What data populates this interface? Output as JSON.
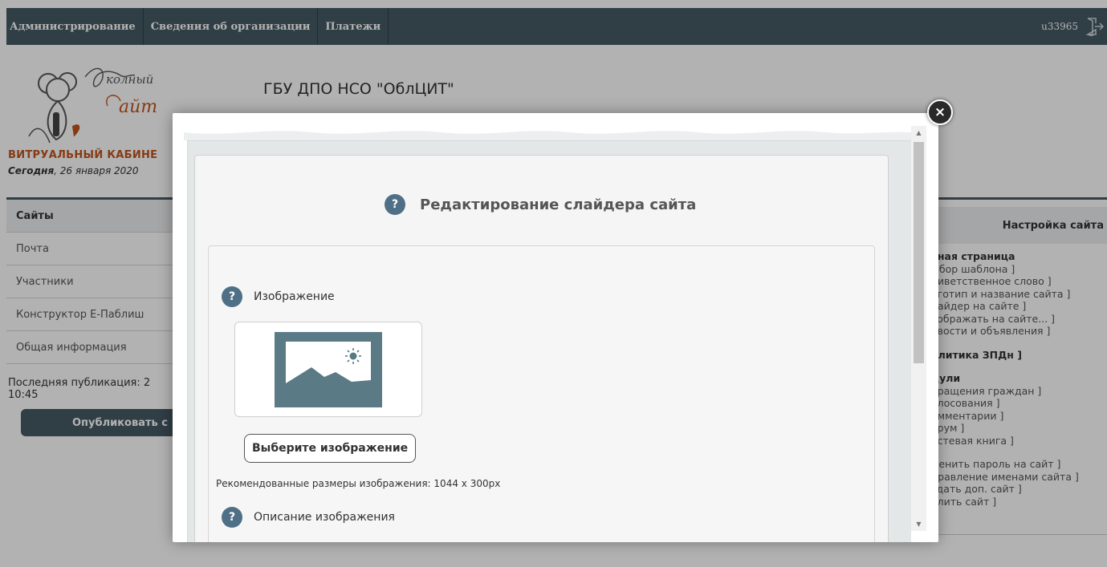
{
  "topnav": {
    "items": [
      "Администрирование",
      "Сведения об организации",
      "Платежи"
    ],
    "user": "u33965"
  },
  "header": {
    "cabinet_title": "ВИТРУАЛЬНЫЙ КАБИНЕ",
    "today_label": "Сегодня",
    "today_date": ", 26 января 2020",
    "org_name": "ГБУ ДПО НСО \"ОблЦИТ\"",
    "logo_text": "Школьный Сайт"
  },
  "sidebar": {
    "items": [
      "Сайты",
      "Почта",
      "Участники",
      "Конструктор Е-Паблиш",
      "Общая информация"
    ],
    "active_index": 0,
    "last_publication": "Последняя публикация: 2",
    "last_publication_time": "10:45",
    "publish_button": "Опубликовать с"
  },
  "right_panel": {
    "title": "Настройка сайта",
    "group1_title": "вная страница",
    "group1_items": [
      "ыбор шаблона ]",
      "риветственное слово ]",
      "оготип и название сайта ]",
      "лайдер на сайте ]",
      "тображать на сайте... ]",
      "овости и объявления ]"
    ],
    "group2_title": "олитика ЗПДн ]",
    "group3_title": "дули",
    "group3_items": [
      "бращения граждан ]",
      "олосования ]",
      "омментарии ]",
      "орум ]",
      "остевая книга ]"
    ],
    "group4_items": [
      "менить пароль на сайт ]",
      "правление именами сайта ]",
      "здать доп. сайт ]",
      "алить сайт ]"
    ]
  },
  "modal": {
    "title": "Редактирование слайдера сайта",
    "help_glyph": "?",
    "image_label": "Изображение",
    "choose_button": "Выберите изображение",
    "recommended": "Рекомендованные размеры изображения: 1044 x 300px",
    "description_label": "Описание изображения",
    "close_glyph": "×"
  },
  "icons": {
    "image_placeholder": "image-placeholder-icon",
    "close": "close-icon",
    "help": "help-icon",
    "exit": "exit-icon"
  },
  "colors": {
    "nav_bg": "#465a63",
    "accent_orange": "#c0541e",
    "help_blue": "#4e6f86",
    "image_icon": "#5a7a86"
  }
}
